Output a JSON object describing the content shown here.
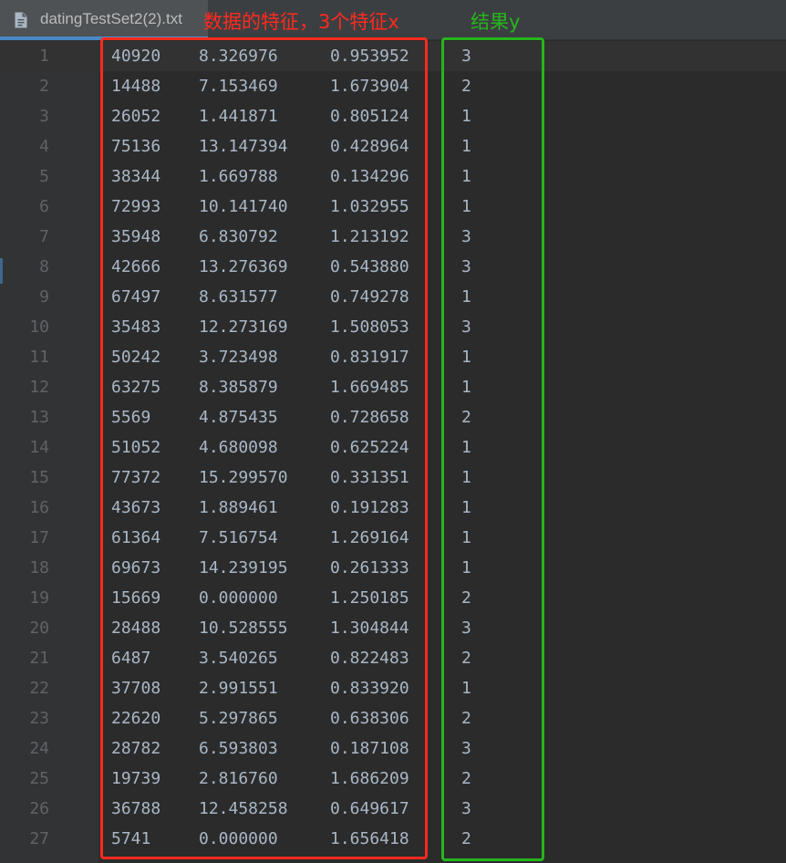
{
  "tab": {
    "title": "datingTestSet2(2).txt",
    "icon": "text-file-icon"
  },
  "annotations": {
    "features_label": "数据的特征，3个特征x",
    "result_label": "结果y",
    "features_color": "#ff2a1f",
    "result_color": "#26b51d"
  },
  "rows": [
    {
      "n": "1",
      "c1": "40920",
      "c2": "8.326976",
      "c3": "0.953952",
      "c4": "3"
    },
    {
      "n": "2",
      "c1": "14488",
      "c2": "7.153469",
      "c3": "1.673904",
      "c4": "2"
    },
    {
      "n": "3",
      "c1": "26052",
      "c2": "1.441871",
      "c3": "0.805124",
      "c4": "1"
    },
    {
      "n": "4",
      "c1": "75136",
      "c2": "13.147394",
      "c3": "0.428964",
      "c4": "1"
    },
    {
      "n": "5",
      "c1": "38344",
      "c2": "1.669788",
      "c3": "0.134296",
      "c4": "1"
    },
    {
      "n": "6",
      "c1": "72993",
      "c2": "10.141740",
      "c3": "1.032955",
      "c4": "1"
    },
    {
      "n": "7",
      "c1": "35948",
      "c2": "6.830792",
      "c3": "1.213192",
      "c4": "3"
    },
    {
      "n": "8",
      "c1": "42666",
      "c2": "13.276369",
      "c3": "0.543880",
      "c4": "3"
    },
    {
      "n": "9",
      "c1": "67497",
      "c2": "8.631577",
      "c3": "0.749278",
      "c4": "1"
    },
    {
      "n": "10",
      "c1": "35483",
      "c2": "12.273169",
      "c3": "1.508053",
      "c4": "3"
    },
    {
      "n": "11",
      "c1": "50242",
      "c2": "3.723498",
      "c3": "0.831917",
      "c4": "1"
    },
    {
      "n": "12",
      "c1": "63275",
      "c2": "8.385879",
      "c3": "1.669485",
      "c4": "1"
    },
    {
      "n": "13",
      "c1": "5569",
      "c2": "4.875435",
      "c3": "0.728658",
      "c4": "2"
    },
    {
      "n": "14",
      "c1": "51052",
      "c2": "4.680098",
      "c3": "0.625224",
      "c4": "1"
    },
    {
      "n": "15",
      "c1": "77372",
      "c2": "15.299570",
      "c3": "0.331351",
      "c4": "1"
    },
    {
      "n": "16",
      "c1": "43673",
      "c2": "1.889461",
      "c3": "0.191283",
      "c4": "1"
    },
    {
      "n": "17",
      "c1": "61364",
      "c2": "7.516754",
      "c3": "1.269164",
      "c4": "1"
    },
    {
      "n": "18",
      "c1": "69673",
      "c2": "14.239195",
      "c3": "0.261333",
      "c4": "1"
    },
    {
      "n": "19",
      "c1": "15669",
      "c2": "0.000000",
      "c3": "1.250185",
      "c4": "2"
    },
    {
      "n": "20",
      "c1": "28488",
      "c2": "10.528555",
      "c3": "1.304844",
      "c4": "3"
    },
    {
      "n": "21",
      "c1": "6487",
      "c2": "3.540265",
      "c3": "0.822483",
      "c4": "2"
    },
    {
      "n": "22",
      "c1": "37708",
      "c2": "2.991551",
      "c3": "0.833920",
      "c4": "1"
    },
    {
      "n": "23",
      "c1": "22620",
      "c2": "5.297865",
      "c3": "0.638306",
      "c4": "2"
    },
    {
      "n": "24",
      "c1": "28782",
      "c2": "6.593803",
      "c3": "0.187108",
      "c4": "3"
    },
    {
      "n": "25",
      "c1": "19739",
      "c2": "2.816760",
      "c3": "1.686209",
      "c4": "2"
    },
    {
      "n": "26",
      "c1": "36788",
      "c2": "12.458258",
      "c3": "0.649617",
      "c4": "3"
    },
    {
      "n": "27",
      "c1": "5741",
      "c2": "0.000000",
      "c3": "1.656418",
      "c4": "2"
    }
  ]
}
